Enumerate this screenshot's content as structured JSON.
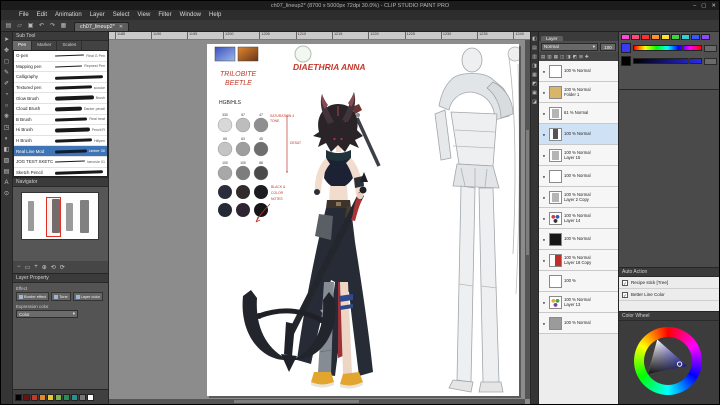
{
  "window": {
    "title": "ch07_lineup2* (8700 x 5000px 72dpi 30.0%) - CLIP STUDIO PAINT PRO",
    "minimize": "–",
    "maximize": "▢",
    "close": "✕"
  },
  "menu": {
    "items": [
      "File",
      "Edit",
      "Animation",
      "Layer",
      "Select",
      "View",
      "Filter",
      "Window",
      "Help"
    ]
  },
  "topbar": {
    "tab": "ch07_lineup2*",
    "tab_close": "✕",
    "icons": [
      {
        "glyph": "▤"
      },
      {
        "glyph": "▱"
      },
      {
        "glyph": "▣"
      },
      {
        "glyph": "↶"
      },
      {
        "glyph": "↷"
      },
      {
        "glyph": "▦"
      }
    ]
  },
  "toolstrip": [
    "➤",
    "✥",
    "◻",
    "✎",
    "✐",
    "◔",
    "○",
    "❋",
    "◳",
    "◐",
    "◧",
    "▨",
    "▤",
    "A",
    "⊙"
  ],
  "midstrip": [
    "◧",
    "▤",
    "▥",
    "◨",
    "▦",
    "◩",
    "▣",
    "◪"
  ],
  "ruler": {
    "ticks": [
      "1185",
      "1190",
      "1195",
      "1200",
      "1205",
      "1210",
      "1215",
      "1220",
      "1225",
      "1230",
      "1235",
      "1240"
    ]
  },
  "subtool": {
    "title": "Sub Tool",
    "tabs": [
      "Pen",
      "Marker",
      "Scales"
    ],
    "brushes": [
      {
        "name": "G-pen",
        "tag": "Real G Pen"
      },
      {
        "name": "Mapping pen",
        "tag": "Repnest Pen"
      },
      {
        "name": "Calligraphy",
        "tag": ""
      },
      {
        "name": "Textured pen",
        "tag": "scouke"
      },
      {
        "name": "Glow Brush",
        "tag": "Brush"
      },
      {
        "name": "Cloud Brush",
        "tag": "Darker pencil"
      },
      {
        "name": "B Brush",
        "tag": "Real treat"
      },
      {
        "name": "Hi Brush",
        "tag": "Pencil R"
      },
      {
        "name": "H Brush",
        "tag": "Hillpen"
      },
      {
        "name": "Real Line Mod",
        "tag": "Limber Oil"
      },
      {
        "name": "JOG TEST SKETCH",
        "tag": "tamovie 01"
      },
      {
        "name": "Sketch Pencil",
        "tag": ""
      }
    ]
  },
  "navigator": {
    "title": "Navigator",
    "controls": [
      "−",
      "▭",
      "+",
      "⊕",
      "⟲",
      "⟳"
    ]
  },
  "layer_property": {
    "title": "Layer Property",
    "effect_label": "Effect",
    "effects": [
      {
        "label": "Border effect"
      },
      {
        "label": "Tone"
      },
      {
        "label": "Layer color"
      }
    ],
    "expression_label": "Expression color",
    "expression_value": "Color",
    "drop_caret": "▾"
  },
  "color_history": {
    "swatches": [
      "#000000",
      "#6b1111",
      "#c0392b",
      "#e2882a",
      "#e8c832",
      "#7ab648",
      "#2e8b57",
      "#2a8f8f",
      "#777777",
      "#ffffff"
    ]
  },
  "canvas": {
    "title_name": "DIAETHRIA ANNA",
    "species_line1": "TRILOBITE",
    "species_line2": "BEETLE",
    "hgb_label": "HGB/HLS",
    "sat_note_1": "SATURATION 4",
    "sat_note_2": "TONE",
    "desat_note": "DESAT",
    "black_note_1": "BLACK &",
    "black_note_2": "COLOR",
    "black_note_3": "NOTES",
    "value_rows": [
      [
        "330",
        "57",
        "47"
      ],
      [
        "65",
        "63",
        "45"
      ],
      [
        "100",
        "100",
        "88"
      ]
    ]
  },
  "layer_panel": {
    "tab": "Layer",
    "blend_mode": "Normal",
    "drop_caret": "▾",
    "opacity": "100",
    "icons": [
      "▤",
      "▥",
      "▦",
      "◫",
      "◨",
      "◩",
      "⊞",
      "✚"
    ],
    "layers": [
      {
        "line1": "100 % Normal",
        "line2": "",
        "eye": "●"
      },
      {
        "line1": "100 % Normal",
        "line2": "Folder 1",
        "eye": "●"
      },
      {
        "line1": "61 % Normal",
        "line2": "",
        "eye": "●"
      },
      {
        "line1": "100 % Normal",
        "line2": "",
        "eye": "●"
      },
      {
        "line1": "100 % Normal",
        "line2": "Layer 15",
        "eye": "●"
      },
      {
        "line1": "100 % Normal",
        "line2": "",
        "eye": "●"
      },
      {
        "line1": "100 % Normal",
        "line2": "Layer 2 Copy",
        "eye": "●"
      },
      {
        "line1": "100 % Normal",
        "line2": "Layer 14",
        "eye": "●"
      },
      {
        "line1": "100 % Normal",
        "line2": "",
        "eye": "●"
      },
      {
        "line1": "100 % Normal",
        "line2": "Layer 18 Copy",
        "eye": "●"
      },
      {
        "line1": "100 %",
        "line2": "",
        "eye": ""
      },
      {
        "line1": "100 % Normal",
        "line2": "Layer 13",
        "eye": "●"
      },
      {
        "line1": "100 % Normal",
        "line2": "",
        "eye": "●"
      }
    ]
  },
  "color_slider": {
    "swatches": [
      "#ff48d8",
      "#ff4878",
      "#ff3030",
      "#ff9030",
      "#ffe030",
      "#40d040",
      "#30d0d0",
      "#3858ff",
      "#9048ff"
    ],
    "current": "#3a3af0"
  },
  "auto_action": {
    "title": "Auto Action",
    "items": [
      {
        "label": "Recipe stick [Tree]",
        "check": "✓"
      },
      {
        "label": "Better Line Color",
        "check": "✓"
      }
    ]
  },
  "color_wheel": {
    "title": "Color Wheel",
    "selected": "#3535f0"
  }
}
